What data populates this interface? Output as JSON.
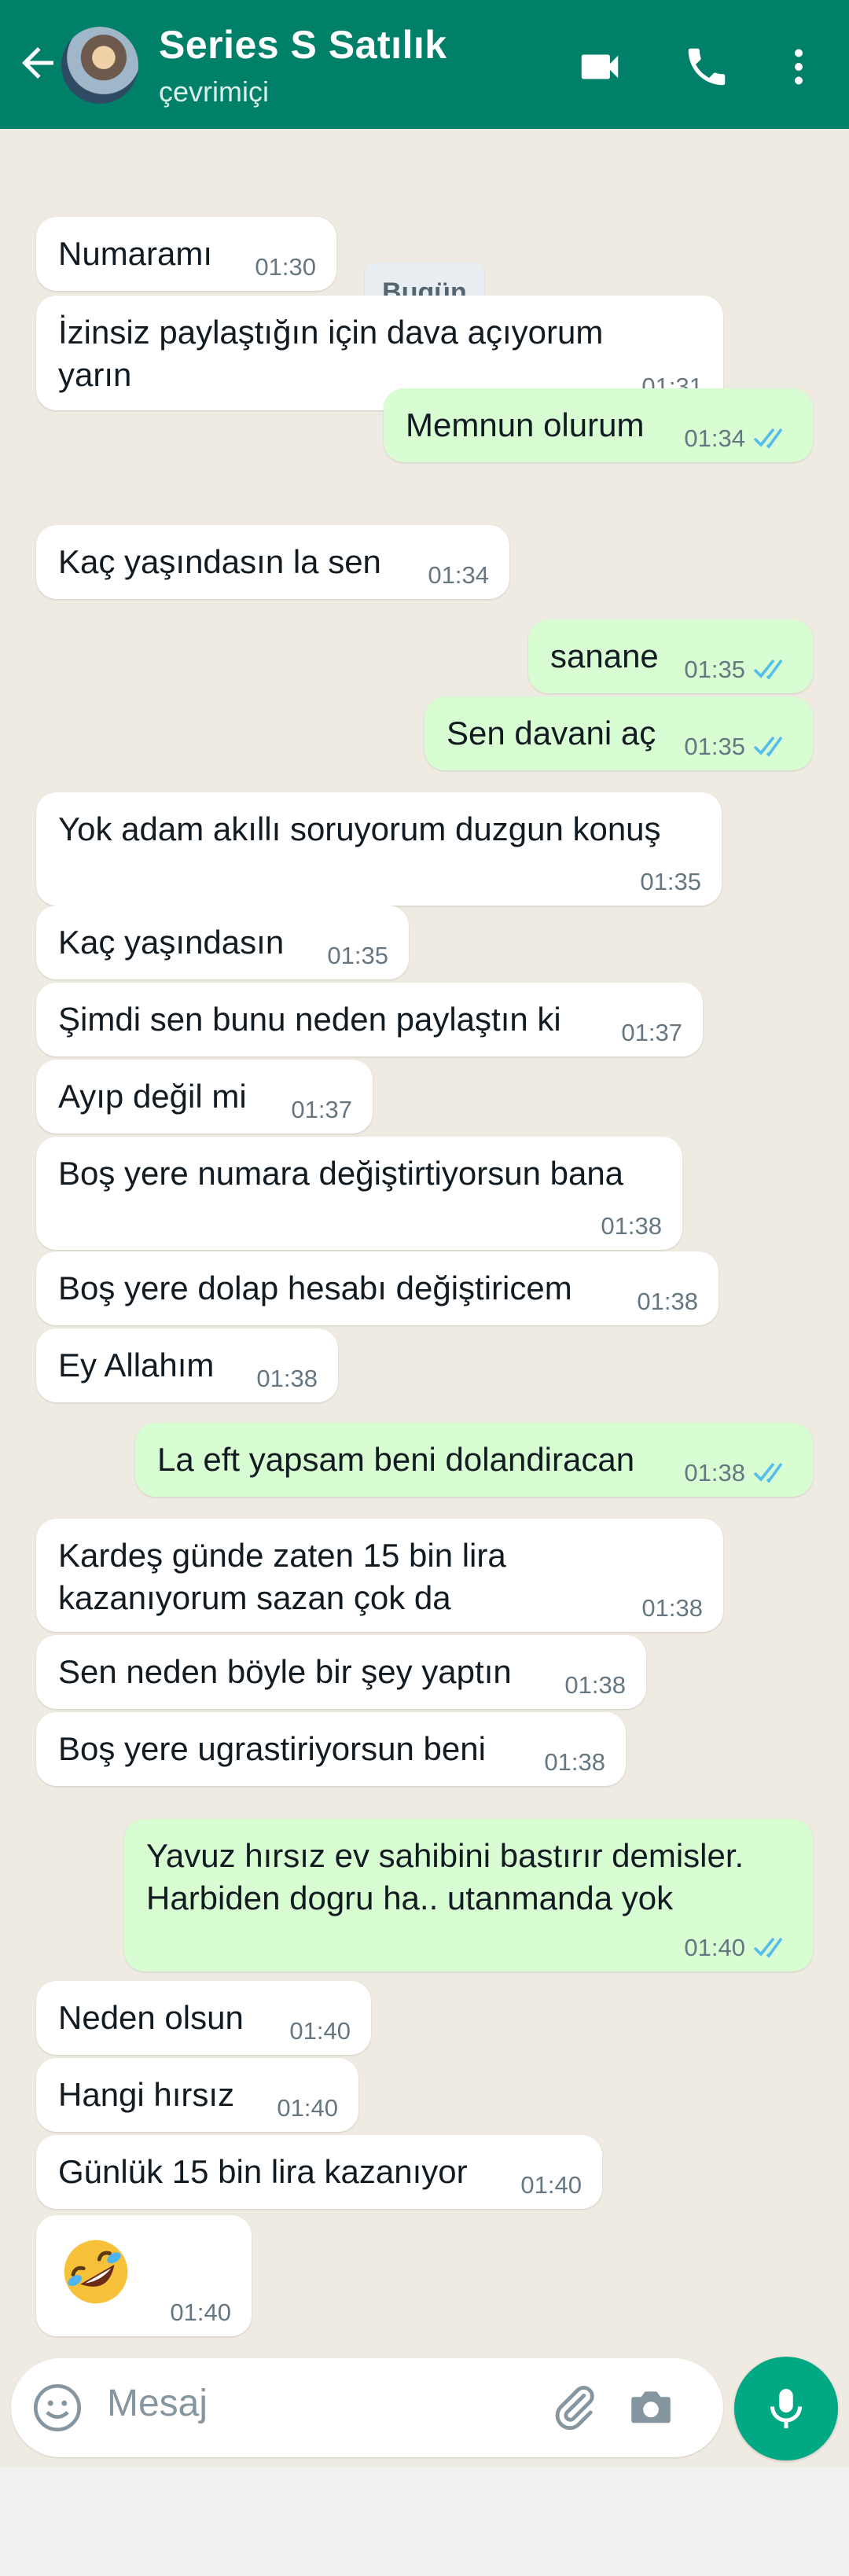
{
  "header": {
    "title": "Series S Satılık",
    "status": "çevrimiçi",
    "back_icon": "back-arrow-icon",
    "video_icon": "video-call-icon",
    "phone_icon": "phone-icon",
    "menu_icon": "more-vertical-icon"
  },
  "date_label": "Bugün",
  "messages": [
    {
      "dir": "in",
      "text": "Numaramı",
      "time": "01:30"
    },
    {
      "dir": "in",
      "text": "İzinsiz paylaştığın için dava açıyorum\nyarın",
      "time": "01:31"
    },
    {
      "dir": "out",
      "text": "Memnun olurum",
      "time": "01:34",
      "read": true
    },
    {
      "dir": "in",
      "text": "Kaç yaşındasın la sen",
      "time": "01:34"
    },
    {
      "dir": "out",
      "text": "sanane",
      "time": "01:35",
      "read": true
    },
    {
      "dir": "out",
      "text": "Sen davani aç",
      "time": "01:35",
      "read": true
    },
    {
      "dir": "in",
      "text": "Yok adam akıllı soruyorum duzgun konuş",
      "time": "01:35"
    },
    {
      "dir": "in",
      "text": "Kaç yaşındasın",
      "time": "01:35"
    },
    {
      "dir": "in",
      "text": "Şimdi sen bunu neden paylaştın ki",
      "time": "01:37"
    },
    {
      "dir": "in",
      "text": "Ayıp değil mi",
      "time": "01:37"
    },
    {
      "dir": "in",
      "text": "Boş yere numara değiştirtiyorsun bana",
      "time": "01:38"
    },
    {
      "dir": "in",
      "text": "Boş yere dolap hesabı değiştiricem",
      "time": "01:38"
    },
    {
      "dir": "in",
      "text": "Ey Allahım",
      "time": "01:38"
    },
    {
      "dir": "out",
      "text": "La eft yapsam beni dolandiracan",
      "time": "01:38",
      "read": true
    },
    {
      "dir": "in",
      "text": "Kardeş günde zaten 15 bin lira\nkazanıyorum sazan çok da",
      "time": "01:38"
    },
    {
      "dir": "in",
      "text": "Sen neden böyle bir şey yaptın",
      "time": "01:38"
    },
    {
      "dir": "in",
      "text": "Boş yere ugrastiriyorsun beni",
      "time": "01:38"
    },
    {
      "dir": "out",
      "text": "Yavuz hırsız ev sahibini bastırır demisler.\nHarbiden dogru ha.. utanmanda yok",
      "time": "01:40",
      "read": true
    },
    {
      "dir": "in",
      "text": "Neden olsun",
      "time": "01:40"
    },
    {
      "dir": "in",
      "text": "Hangi hırsız",
      "time": "01:40"
    },
    {
      "dir": "in",
      "text": "Günlük 15 bin lira kazanıyor",
      "time": "01:40"
    },
    {
      "dir": "in",
      "text": "",
      "time": "01:40",
      "emoji": "rolling-on-floor-laughing-emoji"
    }
  ],
  "composer": {
    "placeholder": "Mesaj",
    "emoji_icon": "emoji-icon",
    "attach_icon": "attachment-icon",
    "camera_icon": "camera-icon",
    "mic_icon": "microphone-icon"
  },
  "colors": {
    "header": "#008069",
    "chat_bg": "#efeae2",
    "incoming": "#ffffff",
    "outgoing": "#d9fdd3",
    "read_tick": "#53bdeb",
    "mic_button": "#00a884"
  }
}
